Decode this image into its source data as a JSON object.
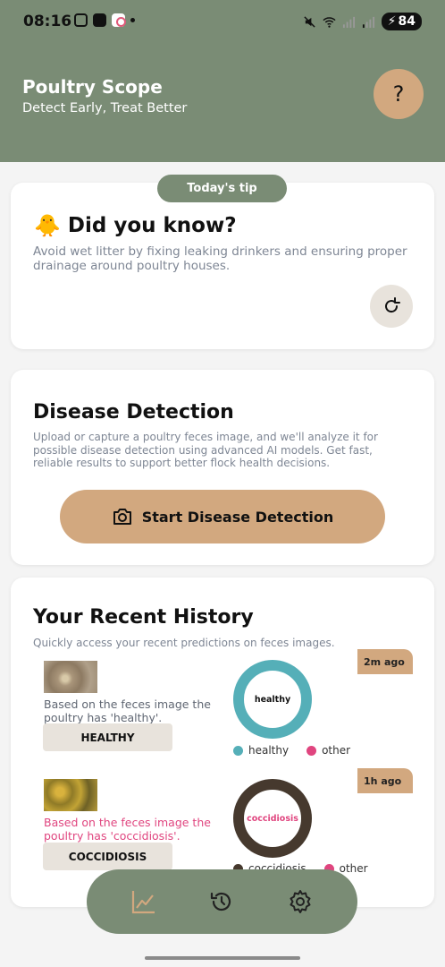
{
  "status_bar": {
    "time": "08:16",
    "battery": "84"
  },
  "header": {
    "title": "Poultry Scope",
    "subtitle": "Detect Early, Treat Better",
    "help_label": "?"
  },
  "tip": {
    "badge": "Today's tip",
    "icon": "chick-emoji",
    "title": "Did you know?",
    "text": "Avoid wet litter by fixing leaking drinkers and ensuring proper drainage around poultry houses."
  },
  "detection": {
    "title": "Disease Detection",
    "text": "Upload or capture a poultry feces image, and we'll analyze it for possible disease detection using advanced AI models. Get fast, reliable results to support better flock health decisions.",
    "button_label": "Start Disease Detection"
  },
  "history": {
    "title": "Your Recent History",
    "subtitle": "Quickly access your recent predictions on feces images.",
    "items": [
      {
        "time_ago": "2m ago",
        "result_text": "Based on the feces image the poultry has 'healthy'.",
        "label": "HEALTHY",
        "donut_label": "healthy",
        "legend": [
          "healthy",
          "other"
        ]
      },
      {
        "time_ago": "1h ago",
        "result_text": "Based on the feces image the poultry has 'coccidiosis'.",
        "label": "COCCIDIOSIS",
        "donut_label": "coccidiosis",
        "legend": [
          "coccidiosis",
          "other"
        ]
      }
    ]
  },
  "colors": {
    "header_green": "#7a8c75",
    "accent_tan": "#d2a87f",
    "healthy_teal": "#55afb8",
    "coccidiosis_brown": "#46392e",
    "other_pink": "#e0457f"
  },
  "nav": {
    "items": [
      "stats-icon",
      "history-icon",
      "settings-icon"
    ]
  }
}
